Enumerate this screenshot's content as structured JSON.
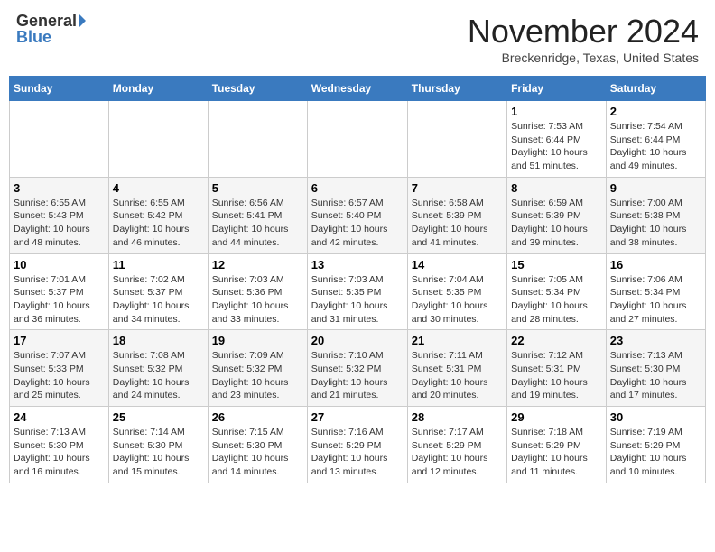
{
  "header": {
    "logo_general": "General",
    "logo_blue": "Blue",
    "title": "November 2024",
    "subtitle": "Breckenridge, Texas, United States"
  },
  "days_of_week": [
    "Sunday",
    "Monday",
    "Tuesday",
    "Wednesday",
    "Thursday",
    "Friday",
    "Saturday"
  ],
  "weeks": [
    [
      {
        "day": "",
        "info": ""
      },
      {
        "day": "",
        "info": ""
      },
      {
        "day": "",
        "info": ""
      },
      {
        "day": "",
        "info": ""
      },
      {
        "day": "",
        "info": ""
      },
      {
        "day": "1",
        "info": "Sunrise: 7:53 AM\nSunset: 6:44 PM\nDaylight: 10 hours and 51 minutes."
      },
      {
        "day": "2",
        "info": "Sunrise: 7:54 AM\nSunset: 6:44 PM\nDaylight: 10 hours and 49 minutes."
      }
    ],
    [
      {
        "day": "3",
        "info": "Sunrise: 6:55 AM\nSunset: 5:43 PM\nDaylight: 10 hours and 48 minutes."
      },
      {
        "day": "4",
        "info": "Sunrise: 6:55 AM\nSunset: 5:42 PM\nDaylight: 10 hours and 46 minutes."
      },
      {
        "day": "5",
        "info": "Sunrise: 6:56 AM\nSunset: 5:41 PM\nDaylight: 10 hours and 44 minutes."
      },
      {
        "day": "6",
        "info": "Sunrise: 6:57 AM\nSunset: 5:40 PM\nDaylight: 10 hours and 42 minutes."
      },
      {
        "day": "7",
        "info": "Sunrise: 6:58 AM\nSunset: 5:39 PM\nDaylight: 10 hours and 41 minutes."
      },
      {
        "day": "8",
        "info": "Sunrise: 6:59 AM\nSunset: 5:39 PM\nDaylight: 10 hours and 39 minutes."
      },
      {
        "day": "9",
        "info": "Sunrise: 7:00 AM\nSunset: 5:38 PM\nDaylight: 10 hours and 38 minutes."
      }
    ],
    [
      {
        "day": "10",
        "info": "Sunrise: 7:01 AM\nSunset: 5:37 PM\nDaylight: 10 hours and 36 minutes."
      },
      {
        "day": "11",
        "info": "Sunrise: 7:02 AM\nSunset: 5:37 PM\nDaylight: 10 hours and 34 minutes."
      },
      {
        "day": "12",
        "info": "Sunrise: 7:03 AM\nSunset: 5:36 PM\nDaylight: 10 hours and 33 minutes."
      },
      {
        "day": "13",
        "info": "Sunrise: 7:03 AM\nSunset: 5:35 PM\nDaylight: 10 hours and 31 minutes."
      },
      {
        "day": "14",
        "info": "Sunrise: 7:04 AM\nSunset: 5:35 PM\nDaylight: 10 hours and 30 minutes."
      },
      {
        "day": "15",
        "info": "Sunrise: 7:05 AM\nSunset: 5:34 PM\nDaylight: 10 hours and 28 minutes."
      },
      {
        "day": "16",
        "info": "Sunrise: 7:06 AM\nSunset: 5:34 PM\nDaylight: 10 hours and 27 minutes."
      }
    ],
    [
      {
        "day": "17",
        "info": "Sunrise: 7:07 AM\nSunset: 5:33 PM\nDaylight: 10 hours and 25 minutes."
      },
      {
        "day": "18",
        "info": "Sunrise: 7:08 AM\nSunset: 5:32 PM\nDaylight: 10 hours and 24 minutes."
      },
      {
        "day": "19",
        "info": "Sunrise: 7:09 AM\nSunset: 5:32 PM\nDaylight: 10 hours and 23 minutes."
      },
      {
        "day": "20",
        "info": "Sunrise: 7:10 AM\nSunset: 5:32 PM\nDaylight: 10 hours and 21 minutes."
      },
      {
        "day": "21",
        "info": "Sunrise: 7:11 AM\nSunset: 5:31 PM\nDaylight: 10 hours and 20 minutes."
      },
      {
        "day": "22",
        "info": "Sunrise: 7:12 AM\nSunset: 5:31 PM\nDaylight: 10 hours and 19 minutes."
      },
      {
        "day": "23",
        "info": "Sunrise: 7:13 AM\nSunset: 5:30 PM\nDaylight: 10 hours and 17 minutes."
      }
    ],
    [
      {
        "day": "24",
        "info": "Sunrise: 7:13 AM\nSunset: 5:30 PM\nDaylight: 10 hours and 16 minutes."
      },
      {
        "day": "25",
        "info": "Sunrise: 7:14 AM\nSunset: 5:30 PM\nDaylight: 10 hours and 15 minutes."
      },
      {
        "day": "26",
        "info": "Sunrise: 7:15 AM\nSunset: 5:30 PM\nDaylight: 10 hours and 14 minutes."
      },
      {
        "day": "27",
        "info": "Sunrise: 7:16 AM\nSunset: 5:29 PM\nDaylight: 10 hours and 13 minutes."
      },
      {
        "day": "28",
        "info": "Sunrise: 7:17 AM\nSunset: 5:29 PM\nDaylight: 10 hours and 12 minutes."
      },
      {
        "day": "29",
        "info": "Sunrise: 7:18 AM\nSunset: 5:29 PM\nDaylight: 10 hours and 11 minutes."
      },
      {
        "day": "30",
        "info": "Sunrise: 7:19 AM\nSunset: 5:29 PM\nDaylight: 10 hours and 10 minutes."
      }
    ]
  ]
}
